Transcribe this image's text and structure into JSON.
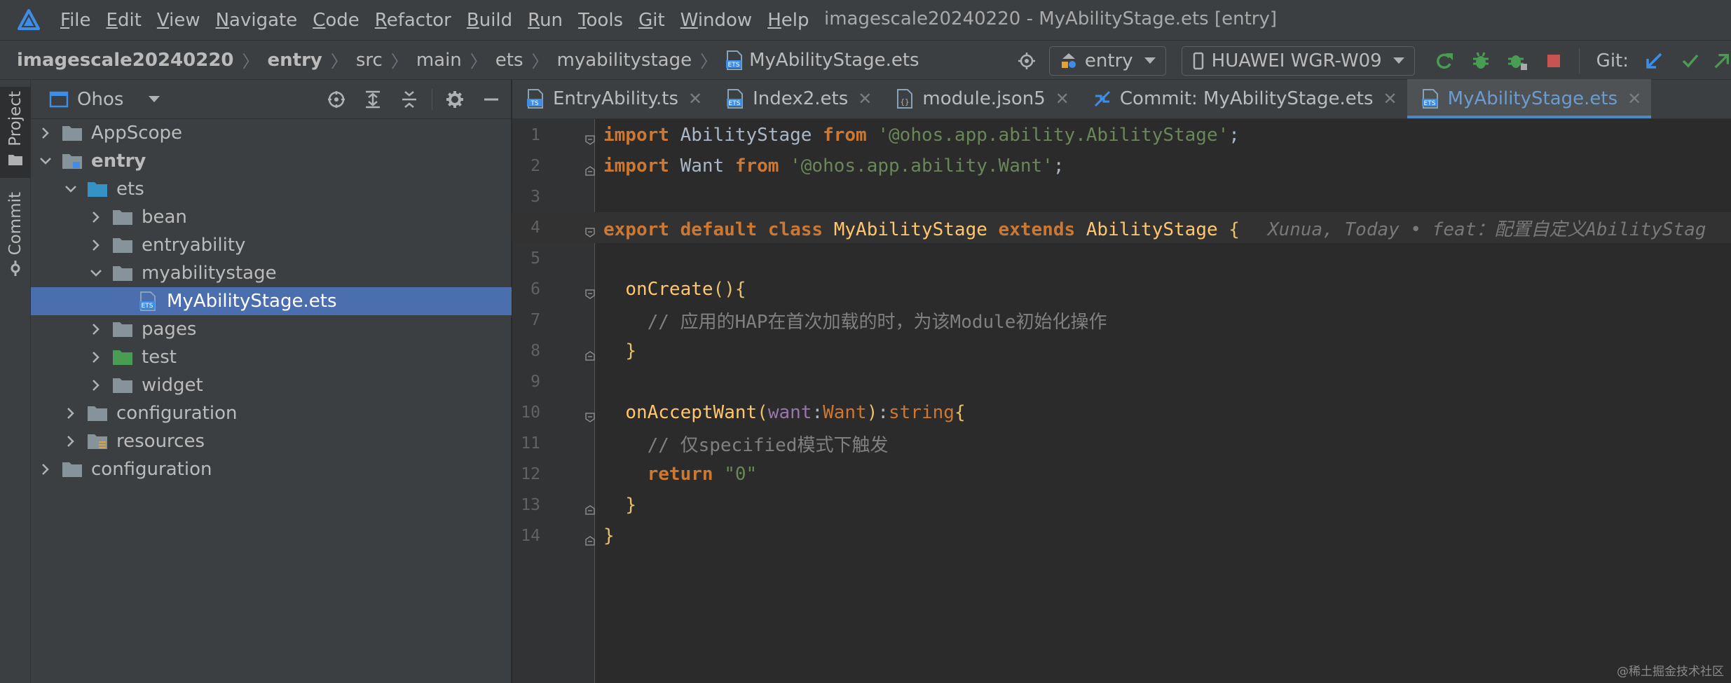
{
  "window_title": "imagescale20240220 - MyAbilityStage.ets [entry]",
  "menu": [
    {
      "mn": "F",
      "rest": "ile"
    },
    {
      "mn": "E",
      "rest": "dit"
    },
    {
      "mn": "V",
      "rest": "iew"
    },
    {
      "mn": "N",
      "rest": "avigate"
    },
    {
      "mn": "C",
      "rest": "ode"
    },
    {
      "mn": "R",
      "rest": "efactor"
    },
    {
      "mn": "B",
      "rest": "uild"
    },
    {
      "mn": "R",
      "rest": "un"
    },
    {
      "mn": "T",
      "rest": "ools"
    },
    {
      "mn": "G",
      "rest": "it"
    },
    {
      "mn": "W",
      "rest": "indow"
    },
    {
      "mn": "H",
      "rest": "elp"
    }
  ],
  "breadcrumb": [
    "imagescale20240220",
    "entry",
    "src",
    "main",
    "ets",
    "myabilitystage",
    "MyAbilityStage.ets"
  ],
  "toolbar": {
    "module": "entry",
    "device": "HUAWEI WGR-W09",
    "git_label": "Git:"
  },
  "side_tabs": {
    "project": "Project",
    "commit": "Commit"
  },
  "project_panel": {
    "title": "Ohos",
    "tree": [
      {
        "label": "AppScope",
        "depth": 0,
        "expanded": false,
        "icon": "folder-icon",
        "bold": false
      },
      {
        "label": "entry",
        "depth": 0,
        "expanded": true,
        "icon": "module-folder-icon",
        "bold": true
      },
      {
        "label": "ets",
        "depth": 1,
        "expanded": true,
        "icon": "source-folder-icon",
        "bold": false
      },
      {
        "label": "bean",
        "depth": 2,
        "expanded": false,
        "icon": "folder-icon",
        "bold": false
      },
      {
        "label": "entryability",
        "depth": 2,
        "expanded": false,
        "icon": "folder-icon",
        "bold": false
      },
      {
        "label": "myabilitystage",
        "depth": 2,
        "expanded": true,
        "icon": "folder-icon",
        "bold": false
      },
      {
        "label": "MyAbilityStage.ets",
        "depth": 3,
        "expanded": null,
        "icon": "ets-file-icon",
        "bold": false,
        "selected": true
      },
      {
        "label": "pages",
        "depth": 2,
        "expanded": false,
        "icon": "folder-icon",
        "bold": false
      },
      {
        "label": "test",
        "depth": 2,
        "expanded": false,
        "icon": "test-folder-icon",
        "bold": false
      },
      {
        "label": "widget",
        "depth": 2,
        "expanded": false,
        "icon": "folder-icon",
        "bold": false
      },
      {
        "label": "configuration",
        "depth": 1,
        "expanded": false,
        "icon": "folder-icon",
        "bold": false
      },
      {
        "label": "resources",
        "depth": 1,
        "expanded": false,
        "icon": "resources-folder-icon",
        "bold": false
      },
      {
        "label": "configuration",
        "depth": 0,
        "expanded": false,
        "icon": "folder-icon",
        "bold": false
      }
    ]
  },
  "tabs": [
    {
      "label": "EntryAbility.ts",
      "icon": "ts-file-icon",
      "active": false
    },
    {
      "label": "Index2.ets",
      "icon": "ets-file-icon",
      "active": false
    },
    {
      "label": "module.json5",
      "icon": "json-file-icon",
      "active": false
    },
    {
      "label": "Commit: MyAbilityStage.ets",
      "icon": "commit-diff-icon",
      "active": false
    },
    {
      "label": "MyAbilityStage.ets",
      "icon": "ets-file-icon",
      "active": true
    }
  ],
  "code": {
    "line_numbers": [
      "1",
      "2",
      "3",
      "4",
      "5",
      "6",
      "7",
      "8",
      "9",
      "10",
      "11",
      "12",
      "13",
      "14"
    ],
    "current_line": 4,
    "blame": "Xunua, Today • feat：配置自定义AbilityStag",
    "lines": [
      [
        [
          "k",
          "import"
        ],
        [
          "p",
          " AbilityStage "
        ],
        [
          "k",
          "from"
        ],
        [
          "p",
          " "
        ],
        [
          "s",
          "'@ohos.app.ability.AbilityStage'"
        ],
        [
          "p",
          ";"
        ]
      ],
      [
        [
          "k",
          "import"
        ],
        [
          "p",
          " Want "
        ],
        [
          "k",
          "from"
        ],
        [
          "p",
          " "
        ],
        [
          "s",
          "'@ohos.app.ability.Want'"
        ],
        [
          "p",
          ";"
        ]
      ],
      [],
      [
        [
          "k",
          "export default class"
        ],
        [
          "p",
          " "
        ],
        [
          "cls",
          "MyAbilityStage"
        ],
        [
          "p",
          " "
        ],
        [
          "k",
          "extends"
        ],
        [
          "p",
          " "
        ],
        [
          "cls",
          "AbilityStage"
        ],
        [
          "p",
          " "
        ],
        [
          "br",
          "{"
        ]
      ],
      [],
      [
        [
          "p",
          "  "
        ],
        [
          "fn",
          "onCreate"
        ],
        [
          "br",
          "(){"
        ]
      ],
      [
        [
          "p",
          "    "
        ],
        [
          "cm",
          "// 应用的HAP在首次加载的时，为该Module初始化操作"
        ]
      ],
      [
        [
          "p",
          "  "
        ],
        [
          "br",
          "}"
        ]
      ],
      [],
      [
        [
          "p",
          "  "
        ],
        [
          "fn",
          "onAcceptWant"
        ],
        [
          "br",
          "("
        ],
        [
          "par",
          "want"
        ],
        [
          "p",
          ":"
        ],
        [
          "kw",
          "Want"
        ],
        [
          "br",
          ")"
        ],
        [
          "p",
          ":"
        ],
        [
          "kw",
          "string"
        ],
        [
          "br",
          "{"
        ]
      ],
      [
        [
          "p",
          "    "
        ],
        [
          "cm",
          "// 仅specified模式下触发"
        ]
      ],
      [
        [
          "p",
          "    "
        ],
        [
          "k",
          "return"
        ],
        [
          "p",
          " "
        ],
        [
          "s",
          "\"0\""
        ]
      ],
      [
        [
          "p",
          "  "
        ],
        [
          "br",
          "}"
        ]
      ],
      [
        [
          "br",
          "}"
        ]
      ]
    ]
  },
  "watermark": "@稀土掘金技术社区",
  "colors": {
    "keyword": "#cc7832",
    "string": "#6a8759",
    "class": "#ffc66d",
    "comment": "#808080",
    "selection": "#4b6eaf",
    "active_tab_text": "#6a9cd0"
  }
}
